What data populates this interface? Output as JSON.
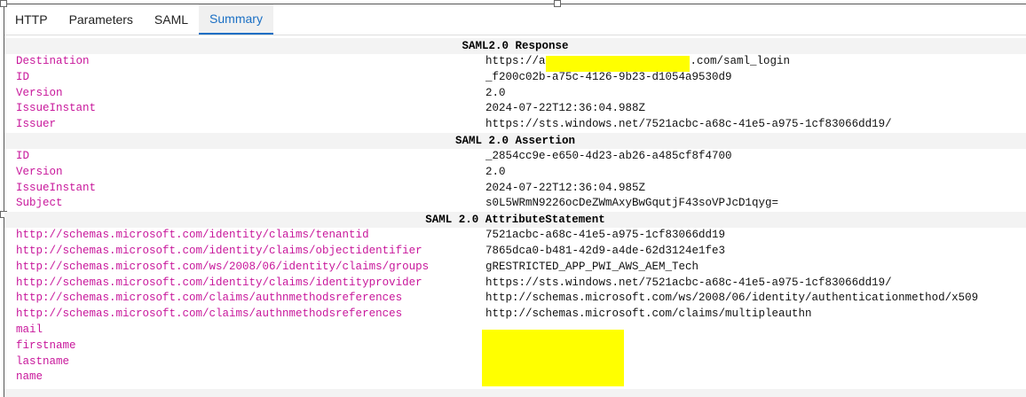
{
  "tabs": [
    {
      "label": "HTTP",
      "active": false
    },
    {
      "label": "Parameters",
      "active": false
    },
    {
      "label": "SAML",
      "active": false
    },
    {
      "label": "Summary",
      "active": true
    }
  ],
  "colors": {
    "key": "#c8179b",
    "accent": "#1a6fc4",
    "redaction": "#ffff00",
    "header_bg": "#f3f3f3"
  },
  "sections": {
    "response": {
      "title": "SAML2.0 Response",
      "rows": [
        {
          "key": "Destination",
          "value_prefix": "https://a",
          "value_suffix": ".com/saml_login"
        },
        {
          "key": "ID",
          "value": "_f200c02b-a75c-4126-9b23-d1054a9530d9"
        },
        {
          "key": "Version",
          "value": "2.0"
        },
        {
          "key": "IssueInstant",
          "value": "2024-07-22T12:36:04.988Z"
        },
        {
          "key": "Issuer",
          "value": "https://sts.windows.net/7521acbc-a68c-41e5-a975-1cf83066dd19/"
        }
      ]
    },
    "assertion": {
      "title": "SAML 2.0 Assertion",
      "rows": [
        {
          "key": "ID",
          "value": "_2854cc9e-e650-4d23-ab26-a485cf8f4700"
        },
        {
          "key": "Version",
          "value": "2.0"
        },
        {
          "key": "IssueInstant",
          "value": "2024-07-22T12:36:04.985Z"
        },
        {
          "key": "Subject",
          "value": "s0L5WRmN9226ocDeZWmAxyBwGqutjF43soVPJcD1qyg="
        }
      ]
    },
    "attributes": {
      "title": "SAML 2.0 AttributeStatement",
      "rows": [
        {
          "key": "http://schemas.microsoft.com/identity/claims/tenantid",
          "value": "7521acbc-a68c-41e5-a975-1cf83066dd19"
        },
        {
          "key": "http://schemas.microsoft.com/identity/claims/objectidentifier",
          "value": "7865dca0-b481-42d9-a4de-62d3124e1fe3"
        },
        {
          "key": "http://schemas.microsoft.com/ws/2008/06/identity/claims/groups",
          "value": "gRESTRICTED_APP_PWI_AWS_AEM_Tech"
        },
        {
          "key": "http://schemas.microsoft.com/identity/claims/identityprovider",
          "value": "https://sts.windows.net/7521acbc-a68c-41e5-a975-1cf83066dd19/"
        },
        {
          "key": "http://schemas.microsoft.com/claims/authnmethodsreferences",
          "value": "http://schemas.microsoft.com/ws/2008/06/identity/authenticationmethod/x509"
        },
        {
          "key": "http://schemas.microsoft.com/claims/authnmethodsreferences",
          "value": "http://schemas.microsoft.com/claims/multipleauthn"
        },
        {
          "key": "mail",
          "value": ""
        },
        {
          "key": "firstname",
          "value": ""
        },
        {
          "key": "lastname",
          "value": ""
        },
        {
          "key": "name",
          "value": ""
        }
      ]
    }
  }
}
